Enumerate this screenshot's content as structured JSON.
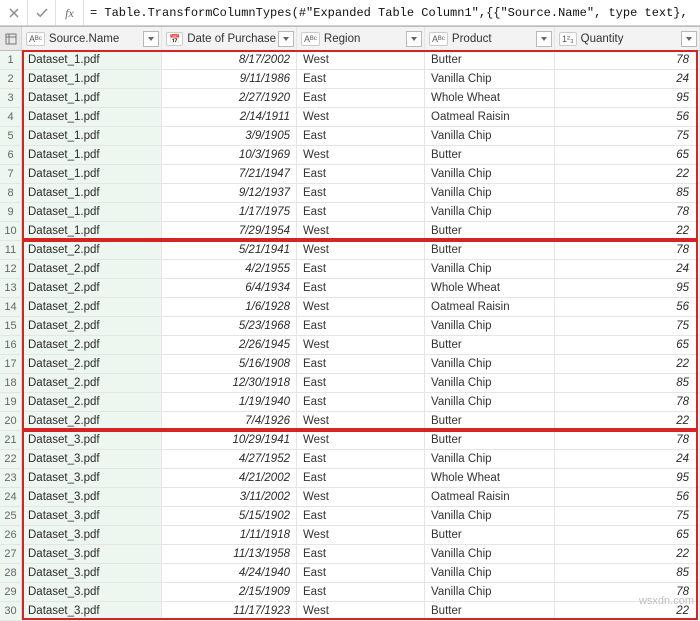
{
  "formula_bar": {
    "fx_label": "fx",
    "text": "= Table.TransformColumnTypes(#\"Expanded Table Column1\",{{\"Source.Name\", type text}, {\"Date of Purchase\", type"
  },
  "columns": {
    "source": {
      "label": "Source.Name",
      "type_icon": "Aᴮᶜ"
    },
    "date": {
      "label": "Date of Purchase",
      "type_icon": "📅"
    },
    "region": {
      "label": "Region",
      "type_icon": "Aᴮᶜ"
    },
    "product": {
      "label": "Product",
      "type_icon": "Aᴮᶜ"
    },
    "quantity": {
      "label": "Quantity",
      "type_icon": "1²₃"
    }
  },
  "rows": [
    {
      "n": 1,
      "source": "Dataset_1.pdf",
      "date": "8/17/2002",
      "region": "West",
      "product": "Butter",
      "quantity": 78
    },
    {
      "n": 2,
      "source": "Dataset_1.pdf",
      "date": "9/11/1986",
      "region": "East",
      "product": "Vanilla Chip",
      "quantity": 24
    },
    {
      "n": 3,
      "source": "Dataset_1.pdf",
      "date": "2/27/1920",
      "region": "East",
      "product": "Whole Wheat",
      "quantity": 95
    },
    {
      "n": 4,
      "source": "Dataset_1.pdf",
      "date": "2/14/1911",
      "region": "West",
      "product": "Oatmeal Raisin",
      "quantity": 56
    },
    {
      "n": 5,
      "source": "Dataset_1.pdf",
      "date": "3/9/1905",
      "region": "East",
      "product": "Vanilla Chip",
      "quantity": 75
    },
    {
      "n": 6,
      "source": "Dataset_1.pdf",
      "date": "10/3/1969",
      "region": "West",
      "product": "Butter",
      "quantity": 65
    },
    {
      "n": 7,
      "source": "Dataset_1.pdf",
      "date": "7/21/1947",
      "region": "East",
      "product": "Vanilla Chip",
      "quantity": 22
    },
    {
      "n": 8,
      "source": "Dataset_1.pdf",
      "date": "9/12/1937",
      "region": "East",
      "product": "Vanilla Chip",
      "quantity": 85
    },
    {
      "n": 9,
      "source": "Dataset_1.pdf",
      "date": "1/17/1975",
      "region": "East",
      "product": "Vanilla Chip",
      "quantity": 78
    },
    {
      "n": 10,
      "source": "Dataset_1.pdf",
      "date": "7/29/1954",
      "region": "West",
      "product": "Butter",
      "quantity": 22
    },
    {
      "n": 11,
      "source": "Dataset_2.pdf",
      "date": "5/21/1941",
      "region": "West",
      "product": "Butter",
      "quantity": 78
    },
    {
      "n": 12,
      "source": "Dataset_2.pdf",
      "date": "4/2/1955",
      "region": "East",
      "product": "Vanilla Chip",
      "quantity": 24
    },
    {
      "n": 13,
      "source": "Dataset_2.pdf",
      "date": "6/4/1934",
      "region": "East",
      "product": "Whole Wheat",
      "quantity": 95
    },
    {
      "n": 14,
      "source": "Dataset_2.pdf",
      "date": "1/6/1928",
      "region": "West",
      "product": "Oatmeal Raisin",
      "quantity": 56
    },
    {
      "n": 15,
      "source": "Dataset_2.pdf",
      "date": "5/23/1968",
      "region": "East",
      "product": "Vanilla Chip",
      "quantity": 75
    },
    {
      "n": 16,
      "source": "Dataset_2.pdf",
      "date": "2/26/1945",
      "region": "West",
      "product": "Butter",
      "quantity": 65
    },
    {
      "n": 17,
      "source": "Dataset_2.pdf",
      "date": "5/16/1908",
      "region": "East",
      "product": "Vanilla Chip",
      "quantity": 22
    },
    {
      "n": 18,
      "source": "Dataset_2.pdf",
      "date": "12/30/1918",
      "region": "East",
      "product": "Vanilla Chip",
      "quantity": 85
    },
    {
      "n": 19,
      "source": "Dataset_2.pdf",
      "date": "1/19/1940",
      "region": "East",
      "product": "Vanilla Chip",
      "quantity": 78
    },
    {
      "n": 20,
      "source": "Dataset_2.pdf",
      "date": "7/4/1926",
      "region": "West",
      "product": "Butter",
      "quantity": 22
    },
    {
      "n": 21,
      "source": "Dataset_3.pdf",
      "date": "10/29/1941",
      "region": "West",
      "product": "Butter",
      "quantity": 78
    },
    {
      "n": 22,
      "source": "Dataset_3.pdf",
      "date": "4/27/1952",
      "region": "East",
      "product": "Vanilla Chip",
      "quantity": 24
    },
    {
      "n": 23,
      "source": "Dataset_3.pdf",
      "date": "4/21/2002",
      "region": "East",
      "product": "Whole Wheat",
      "quantity": 95
    },
    {
      "n": 24,
      "source": "Dataset_3.pdf",
      "date": "3/11/2002",
      "region": "West",
      "product": "Oatmeal Raisin",
      "quantity": 56
    },
    {
      "n": 25,
      "source": "Dataset_3.pdf",
      "date": "5/15/1902",
      "region": "East",
      "product": "Vanilla Chip",
      "quantity": 75
    },
    {
      "n": 26,
      "source": "Dataset_3.pdf",
      "date": "1/11/1918",
      "region": "West",
      "product": "Butter",
      "quantity": 65
    },
    {
      "n": 27,
      "source": "Dataset_3.pdf",
      "date": "11/13/1958",
      "region": "East",
      "product": "Vanilla Chip",
      "quantity": 22
    },
    {
      "n": 28,
      "source": "Dataset_3.pdf",
      "date": "4/24/1940",
      "region": "East",
      "product": "Vanilla Chip",
      "quantity": 85
    },
    {
      "n": 29,
      "source": "Dataset_3.pdf",
      "date": "2/15/1909",
      "region": "East",
      "product": "Vanilla Chip",
      "quantity": 78
    },
    {
      "n": 30,
      "source": "Dataset_3.pdf",
      "date": "11/17/1923",
      "region": "West",
      "product": "Butter",
      "quantity": 22
    }
  ],
  "watermark": "wsxdn.com"
}
